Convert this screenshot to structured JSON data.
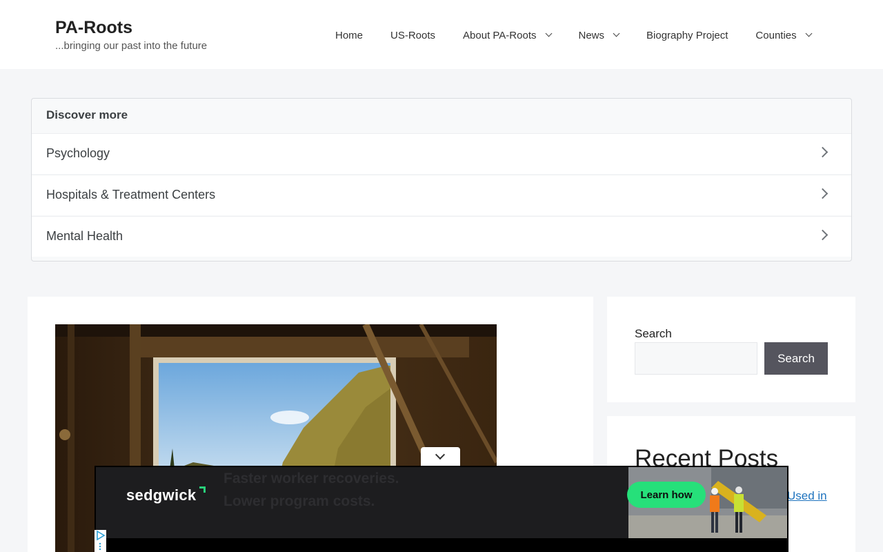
{
  "header": {
    "site_title": "PA-Roots",
    "tagline": "...bringing our past into the future",
    "nav": [
      {
        "label": "Home",
        "has_dropdown": false
      },
      {
        "label": "US-Roots",
        "has_dropdown": false
      },
      {
        "label": "About PA-Roots",
        "has_dropdown": true
      },
      {
        "label": "News",
        "has_dropdown": true
      },
      {
        "label": "Biography Project",
        "has_dropdown": false
      },
      {
        "label": "Counties",
        "has_dropdown": true
      }
    ]
  },
  "discover": {
    "title": "Discover more",
    "items": [
      {
        "label": "Psychology"
      },
      {
        "label": "Hospitals & Treatment Centers"
      },
      {
        "label": "Mental Health"
      }
    ]
  },
  "sidebar": {
    "search_label": "Search",
    "search_value": "",
    "search_button": "Search",
    "recent_posts_title": "Recent Posts",
    "recent_post_link_fragment": "Used in"
  },
  "ad": {
    "brand": "sedgwick",
    "headline_line1": "Faster worker recoveries.",
    "headline_line2": "Lower program costs.",
    "cta": "Learn how",
    "colors": {
      "accent": "#26e07a",
      "background": "#1d1d1f"
    }
  }
}
